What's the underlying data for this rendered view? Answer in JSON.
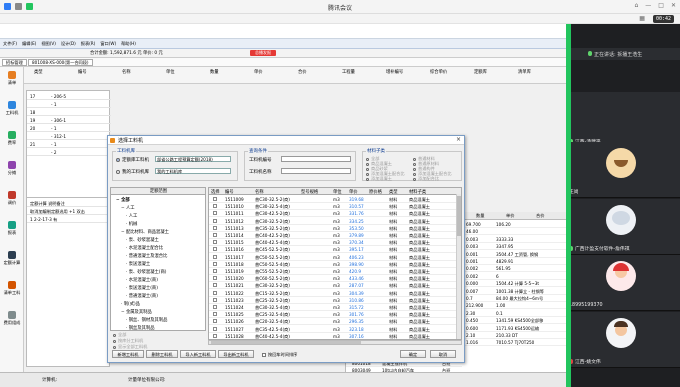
{
  "meeting": {
    "title": "腾讯会议",
    "timer": "00:42",
    "sharing_label": "正在讲话: 拆播王浩生",
    "participants": [
      {
        "name": "江西-汤建平"
      },
      {
        "name": "王尚"
      },
      {
        "name": "广西计盈支付软件-詹伟祺"
      },
      {
        "name": "18995199370"
      },
      {
        "name": "江西-姚文伟"
      }
    ]
  },
  "app": {
    "menu": [
      "文件(F)",
      "编辑(E)",
      "视图(V)",
      "设计(D)",
      "报表(R)",
      "窗口(W)",
      "帮助(H)"
    ],
    "summary": "合计金额: 1,592,871.6 元   单价: 0 元",
    "status_badge": "总播发报",
    "tabs": [
      "招标管理",
      "801008-XS-000(第一合同段)"
    ],
    "sidebar": [
      {
        "label": "清单"
      },
      {
        "label": "工料机"
      },
      {
        "label": "费率"
      },
      {
        "label": "分摊"
      },
      {
        "label": "调价"
      },
      {
        "label": "报表"
      },
      {
        "label": "定额计算"
      },
      {
        "label": "清单工料"
      },
      {
        "label": "费用组成"
      }
    ],
    "column_head": [
      "类型",
      "编号",
      "名称",
      "单位",
      "数量",
      "单价",
      "合价",
      "工程量",
      "增补编号",
      "综合单价",
      "定额库",
      "清单库"
    ],
    "tree_rows": [
      {
        "id": "17",
        "code": "- 206-5"
      },
      {
        "id": "",
        "code": "- 1"
      },
      {
        "id": "18",
        "code": ""
      },
      {
        "id": "19",
        "code": "- 306-1"
      },
      {
        "id": "20",
        "code": "- 1"
      },
      {
        "id": "",
        "code": "- 312-1"
      },
      {
        "id": "21",
        "code": "- 1"
      },
      {
        "id": "",
        "code": "- 2"
      }
    ],
    "lower_panel_rows": [
      "定额计算 说明备注",
      "取消加编制定额选用 +1 双击",
      "1  2-2-17-3  有"
    ],
    "status_left": "计算机:",
    "status_right": "计量单位有限公司:"
  },
  "dialog": {
    "title": "选择工料机",
    "source_group": "工料机库",
    "source_opt1": "定额库工料机",
    "source_opt1_value": "部省公路工程预算定额(2018)",
    "source_opt2": "我的工料机库",
    "source_opt2_value": "我的工料机库",
    "query_group": "查询条件",
    "query_code_label": "工料机编号",
    "query_name_label": "工料机名称",
    "material_group": "材料子类",
    "material_opts": [
      "全部",
      "普通材料",
      "商品混凝土",
      "普通原材料",
      "商品砂浆",
      "普通构件",
      "添加混凝土配合比",
      "添加混凝土配合比",
      "添加混凝土",
      "添加配合比"
    ],
    "tree_header": "定额范围",
    "tree_items": [
      "全部",
      "人工",
      "人工",
      "机械",
      "配比材料、商品混凝土",
      "泵、砂浆混凝土",
      "水泥混凝土配合比",
      "普通混凝土及混合比",
      "泵送混凝土",
      "泵、砂浆混凝土(商)",
      "水泥混凝土(商)",
      "泵送混凝土(商)",
      "普通混凝土(商)",
      "制(式)品",
      "金属及其制品",
      "钢丝、钢材及其制品",
      "钢丝及其制品"
    ],
    "tree_options": [
      "全部",
      "按库分工料机",
      "显示全部工料机"
    ],
    "grid_headers": [
      "选择",
      "编号",
      "名称",
      "型号规格",
      "单位",
      "单价",
      "原价格",
      "类型",
      "材料子类"
    ],
    "grid_rows": [
      {
        "code": "1511009",
        "name": "普C30-32.5-2(商)",
        "unit": "m3",
        "price": "319.68",
        "type": "材料",
        "sub": "商品混凝土"
      },
      {
        "code": "1511010",
        "name": "普C30-32.5-4(商)",
        "unit": "m3",
        "price": "310.57",
        "type": "材料",
        "sub": "商品混凝土"
      },
      {
        "code": "1511011",
        "name": "普C30-42.5-2(商)",
        "unit": "m3",
        "price": "331.76",
        "type": "材料",
        "sub": "商品混凝土"
      },
      {
        "code": "1511012",
        "name": "普C30-32.5-2(商)",
        "unit": "m3",
        "price": "334.25",
        "type": "材料",
        "sub": "商品混凝土"
      },
      {
        "code": "1511013",
        "name": "普C35-32.5-2(商)",
        "unit": "m3",
        "price": "353.50",
        "type": "材料",
        "sub": "商品混凝土"
      },
      {
        "code": "1511014",
        "name": "普C40-42.5-2(商)",
        "unit": "m3",
        "price": "379.89",
        "type": "材料",
        "sub": "商品混凝土"
      },
      {
        "code": "1511015",
        "name": "普C40-42.5-4(商)",
        "unit": "m3",
        "price": "370.34",
        "type": "材料",
        "sub": "商品混凝土"
      },
      {
        "code": "1511016",
        "name": "普C45-52.5-2(商)",
        "unit": "m3",
        "price": "395.17",
        "type": "材料",
        "sub": "商品混凝土"
      },
      {
        "code": "1511017",
        "name": "普C50-52.5-2(商)",
        "unit": "m3",
        "price": "406.23",
        "type": "材料",
        "sub": "商品混凝土"
      },
      {
        "code": "1511018",
        "name": "普C50-52.5-4(商)",
        "unit": "m3",
        "price": "398.90",
        "type": "材料",
        "sub": "商品混凝土"
      },
      {
        "code": "1511019",
        "name": "普C55-52.5-2(商)",
        "unit": "m3",
        "price": "420.9",
        "type": "材料",
        "sub": "商品混凝土"
      },
      {
        "code": "1511020",
        "name": "普C60-52.5-2(商)",
        "unit": "m3",
        "price": "433.46",
        "type": "材料",
        "sub": "商品混凝土"
      },
      {
        "code": "1511021",
        "name": "普C30-32.5-2(商)",
        "unit": "m3",
        "price": "287.07",
        "type": "材料",
        "sub": "商品混凝土"
      },
      {
        "code": "1511022",
        "name": "普C15-32.5-2(商)",
        "unit": "m3",
        "price": "304.39",
        "type": "材料",
        "sub": "商品混凝土"
      },
      {
        "code": "1511023",
        "name": "普C25-32.5-2(商)",
        "unit": "m3",
        "price": "310.86",
        "type": "材料",
        "sub": "商品混凝土"
      },
      {
        "code": "1511024",
        "name": "普C30-32.5-4(商)",
        "unit": "m3",
        "price": "315.72",
        "type": "材料",
        "sub": "商品混凝土"
      },
      {
        "code": "1511025",
        "name": "普C25-32.5-4(商)",
        "unit": "m3",
        "price": "301.76",
        "type": "材料",
        "sub": "商品混凝土"
      },
      {
        "code": "1511026",
        "name": "普C20-32.5-4(商)",
        "unit": "m3",
        "price": "296.35",
        "type": "材料",
        "sub": "商品混凝土"
      },
      {
        "code": "1511027",
        "name": "普C35-42.5-4(商)",
        "unit": "m3",
        "price": "323.18",
        "type": "材料",
        "sub": "商品混凝土"
      },
      {
        "code": "1511028",
        "name": "普C40-42.5-4(商)",
        "unit": "m3",
        "price": "307.16",
        "type": "材料",
        "sub": "商品混凝土"
      }
    ],
    "buttons": [
      "新增工料机",
      "删除工料机",
      "导入新工料机",
      "导出新工料机",
      "按回车时间排序",
      "确定",
      "取消"
    ]
  },
  "right_table": {
    "headers": [
      "调整单价",
      "规格",
      "单位",
      "数量",
      "单价",
      "合价"
    ],
    "rows": [
      [
        "69.700",
        "106.20",
        "",
        "",
        "",
        "",
        ""
      ],
      [
        "46.00",
        "",
        "",
        "",
        "",
        "",
        ""
      ],
      [
        "0.003",
        "3333.33",
        "",
        "",
        "",
        "",
        ""
      ],
      [
        "0.003",
        "3347.95",
        "",
        "",
        "",
        "",
        ""
      ],
      [
        "0.001",
        "3504.47 工资管, 换钢",
        "",
        "",
        "",
        "",
        ""
      ],
      [
        "0.001",
        "4829.91",
        "",
        "",
        "",
        "",
        ""
      ],
      [
        "0.002",
        "561.95",
        "",
        "",
        "",
        "",
        ""
      ],
      [
        "0.002",
        "6",
        "",
        "",
        "",
        "",
        ""
      ],
      [
        "0.000",
        "1504.42 计算 5-5~3t",
        "",
        "",
        "",
        "",
        ""
      ],
      [
        "0.007",
        "1001.38 计算立 - 柱钢等",
        "",
        "",
        "",
        "",
        ""
      ],
      [
        "0.7",
        "84.00 最大拉钩4~6m号",
        "",
        "",
        "",
        "",
        ""
      ],
      [
        "212.900",
        "1.00",
        "",
        "",
        "",
        "",
        ""
      ],
      [
        "2.30",
        "0.1",
        "",
        "",
        "",
        "",
        ""
      ],
      [
        "0.450",
        "1341.59 KS4500全部移",
        "",
        "",
        "",
        "",
        ""
      ],
      [
        "0.600",
        "1171.93 KS4500运输",
        "",
        "",
        "",
        "",
        ""
      ],
      [
        "2.10",
        "210.33 DT",
        "",
        "",
        "",
        "",
        ""
      ],
      [
        "1.016",
        "7010.57 TJ70T250",
        "",
        "",
        "",
        "",
        ""
      ]
    ],
    "left_rows": [
      [
        "8001004",
        "混凝土搅拌站",
        "台班"
      ],
      [
        "8003005",
        "混凝土运输车",
        "台班"
      ],
      [
        "8001018",
        "混凝土搅拌机",
        "台班"
      ],
      [
        "8003049",
        "10t以内自卸汽车",
        "台班"
      ],
      [
        "9999001",
        "基价",
        "元"
      ]
    ],
    "last_total": "64184.000"
  }
}
